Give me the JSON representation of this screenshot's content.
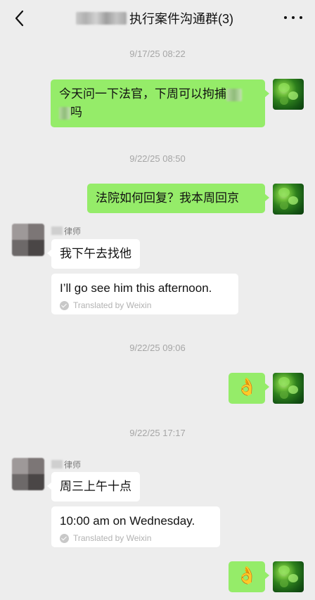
{
  "header": {
    "title": "执行案件沟通群(3)",
    "back_icon": "chevron-left-icon",
    "more_icon": "more-dots-icon"
  },
  "messages": [
    {
      "type": "time",
      "text": "9/17/25 08:22"
    },
    {
      "type": "self",
      "text_line1": "今天问一下法官，下周可以拘捕",
      "text_line2": "吗"
    },
    {
      "type": "time",
      "text": "9/22/25 08:50"
    },
    {
      "type": "self",
      "text": "法院如何回复？我本周回京"
    },
    {
      "type": "other",
      "sender": "律师",
      "text": "我下午去找他",
      "translation": "I’ll go see him this afternoon.",
      "translated_by": "Translated by Weixin"
    },
    {
      "type": "time",
      "text": "9/22/25 09:06"
    },
    {
      "type": "self",
      "text": "👌"
    },
    {
      "type": "time",
      "text": "9/22/25 17:17"
    },
    {
      "type": "other",
      "sender": "律师",
      "text": "周三上午十点",
      "translation": "10:00 am on Wednesday.",
      "translated_by": "Translated by Weixin"
    },
    {
      "type": "self",
      "text": "👌"
    }
  ],
  "colors": {
    "self_bubble": "#95ec69",
    "other_bubble": "#ffffff",
    "background": "#ededed"
  }
}
